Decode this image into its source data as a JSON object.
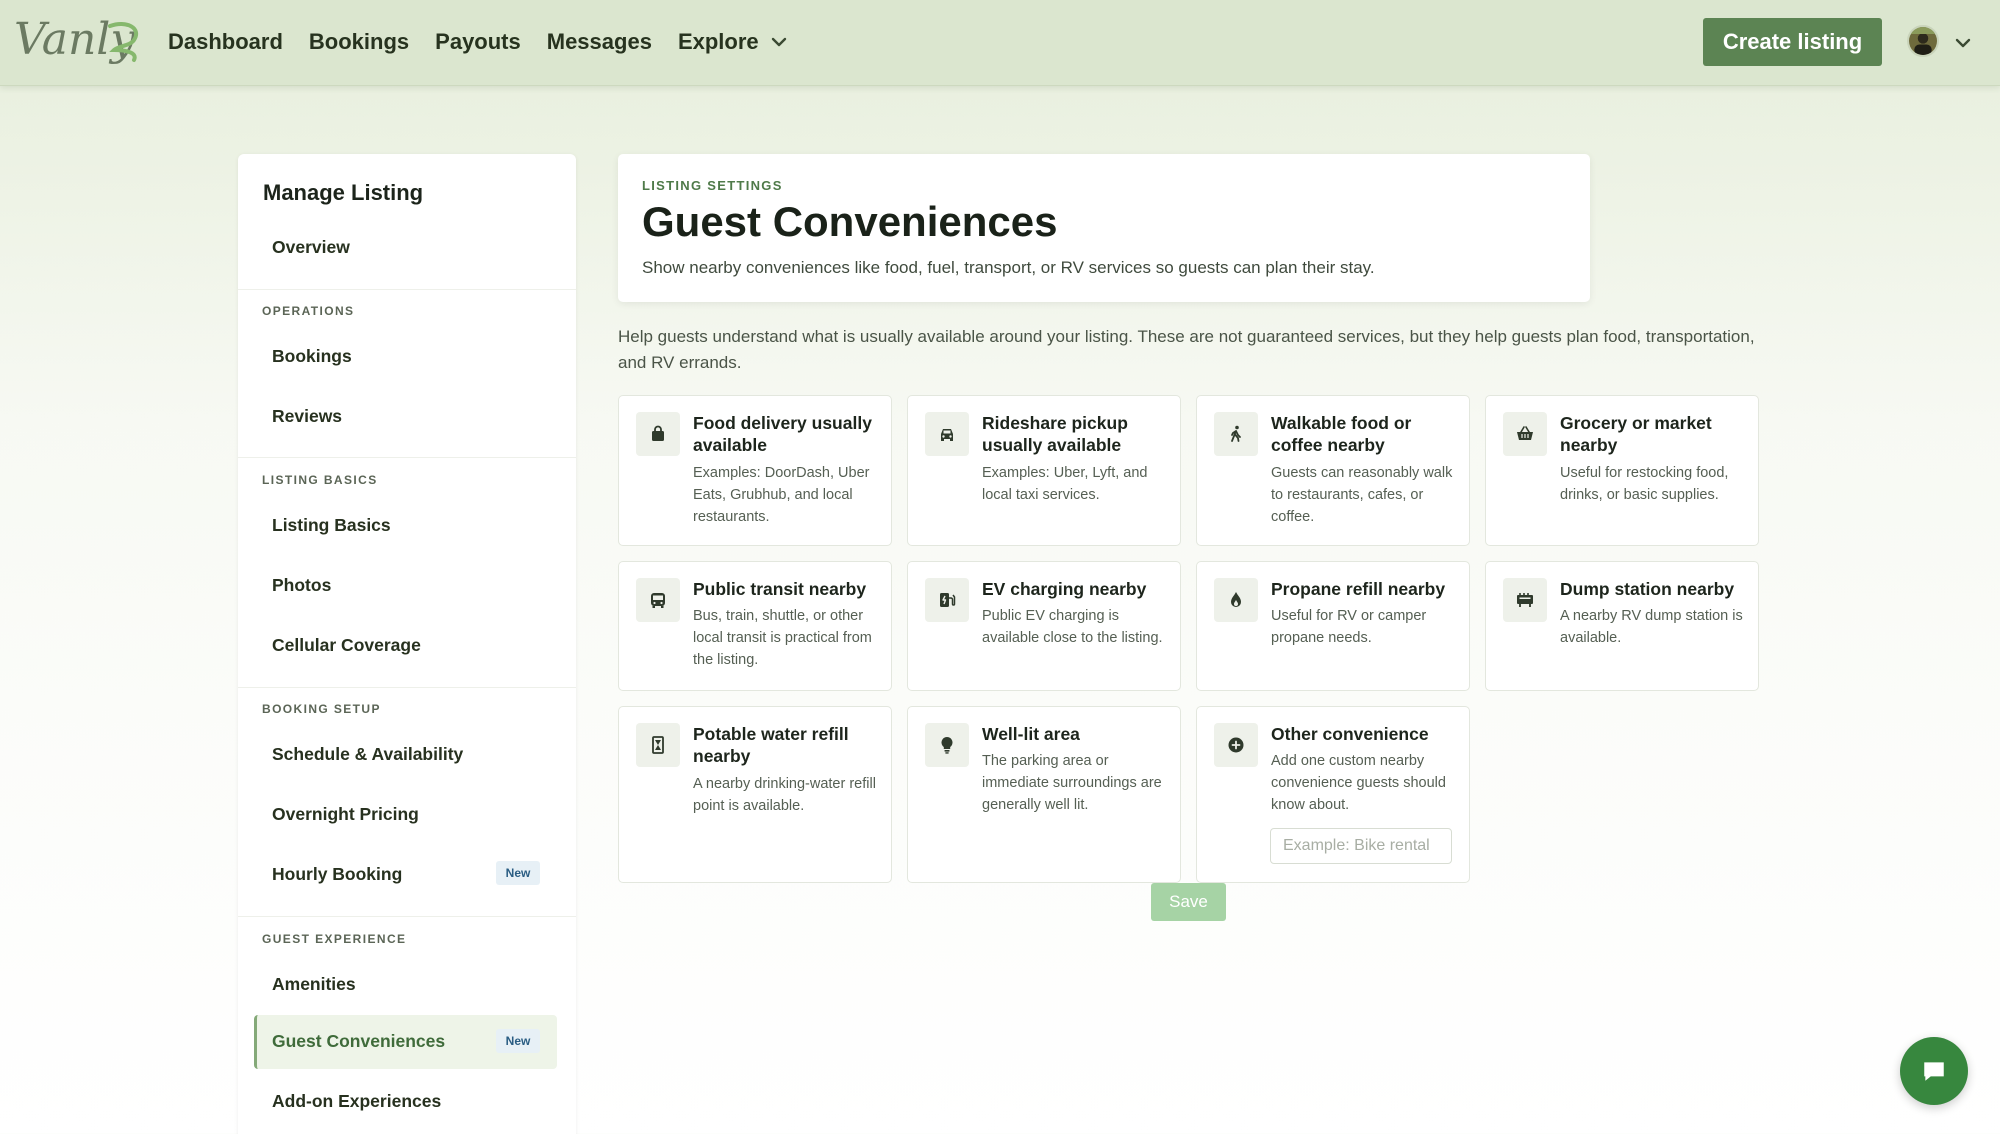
{
  "app": {
    "logo_text": "Vanly",
    "nav": [
      {
        "label": "Dashboard"
      },
      {
        "label": "Bookings"
      },
      {
        "label": "Payouts"
      },
      {
        "label": "Messages"
      },
      {
        "label": "Explore"
      }
    ],
    "create_label": "Create listing"
  },
  "sidebar": {
    "title": "Manage Listing",
    "overview": "Overview",
    "sections": {
      "operations": "OPERATIONS",
      "listing_basics": "LISTING BASICS",
      "booking_setup": "BOOKING SETUP",
      "guest_experience": "GUEST EXPERIENCE"
    },
    "items": {
      "bookings": "Bookings",
      "reviews": "Reviews",
      "listing_basics": "Listing Basics",
      "photos": "Photos",
      "cellular": "Cellular Coverage",
      "schedule": "Schedule & Availability",
      "overnight": "Overnight Pricing",
      "hourly": "Hourly Booking",
      "amenities": "Amenities",
      "guest_conveniences": "Guest Conveniences",
      "addon": "Add-on Experiences"
    },
    "badge_new": "New"
  },
  "header": {
    "eyebrow": "LISTING SETTINGS",
    "title": "Guest Conveniences",
    "subtitle": "Show nearby conveniences like food, fuel, transport, or RV services so guests can plan their stay."
  },
  "help_text": "Help guests understand what is usually available around your listing. These are not guaranteed services, but they help guests plan food, transportation, and RV errands.",
  "cards": [
    {
      "title": "Food delivery usually available",
      "desc": "Examples: DoorDash, Uber Eats, Grubhub, and local restaurants.",
      "icon": "shopping-bag-icon"
    },
    {
      "title": "Rideshare pickup usually available",
      "desc": "Examples: Uber, Lyft, and local taxi services.",
      "icon": "car-icon"
    },
    {
      "title": "Walkable food or coffee nearby",
      "desc": "Guests can reasonably walk to restaurants, cafes, or coffee.",
      "icon": "walking-person-icon"
    },
    {
      "title": "Grocery or market nearby",
      "desc": "Useful for restocking food, drinks, or basic supplies.",
      "icon": "basket-icon"
    },
    {
      "title": "Public transit nearby",
      "desc": "Bus, train, shuttle, or other local transit is practical from the listing.",
      "icon": "bus-icon"
    },
    {
      "title": "EV charging nearby",
      "desc": "Public EV charging is available close to the listing.",
      "icon": "ev-charger-icon"
    },
    {
      "title": "Propane refill nearby",
      "desc": "Useful for RV or camper propane needs.",
      "icon": "flame-icon"
    },
    {
      "title": "Dump station nearby",
      "desc": "A nearby RV dump station is available.",
      "icon": "dump-station-icon"
    },
    {
      "title": "Potable water refill nearby",
      "desc": "A nearby drinking-water refill point is available.",
      "icon": "water-bottle-icon"
    },
    {
      "title": "Well-lit area",
      "desc": "The parking area or immediate surroundings are generally well lit.",
      "icon": "lightbulb-icon"
    },
    {
      "title": "Other convenience",
      "desc": "Add one custom nearby convenience guests should know about.",
      "icon": "plus-circle-icon"
    }
  ],
  "other_input": {
    "placeholder": "Example: Bike rental",
    "value": ""
  },
  "save_label": "Save",
  "colors": {
    "brand": "#5c8453",
    "active_bg": "#eef4e8",
    "save_disabled": "#a6d3a5",
    "chat": "#37873e"
  }
}
